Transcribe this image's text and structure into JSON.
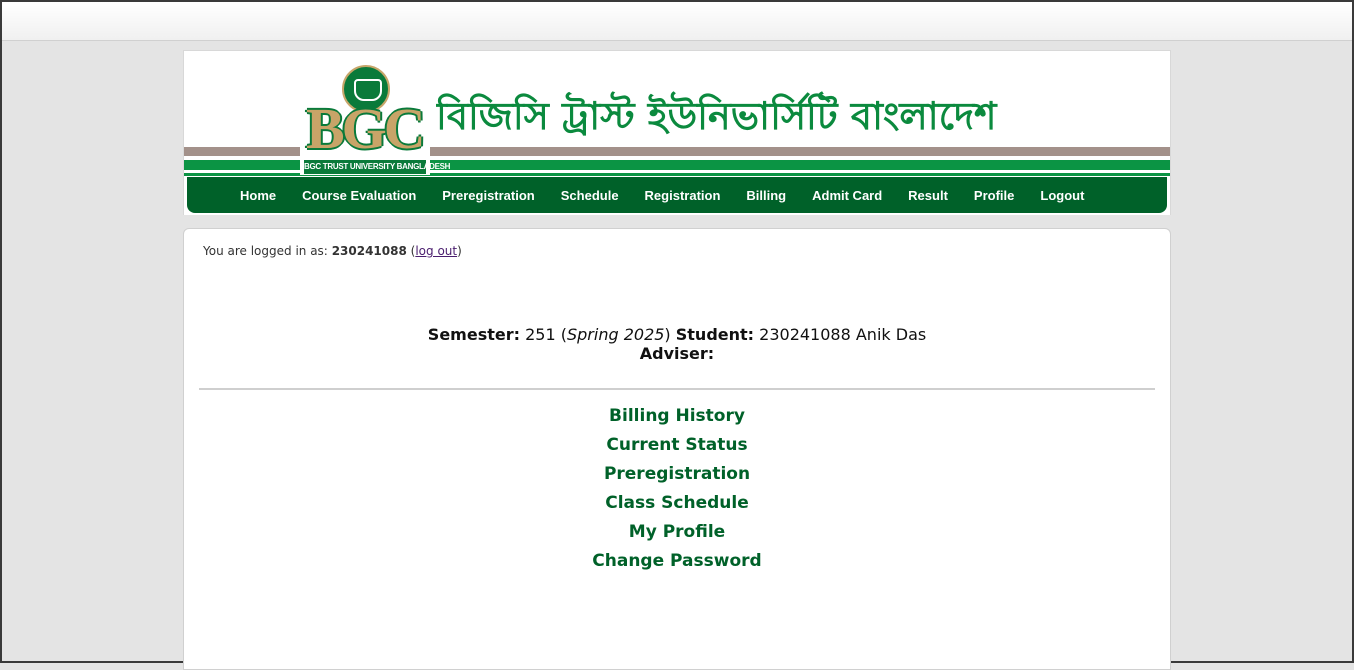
{
  "header": {
    "logo_letters": "BGC",
    "logo_caption": "BGC TRUST UNIVERSITY BANGLADESH",
    "bangla_title": "বিজিসি ট্রাস্ট ইউনিভার্সিটি বাংলাদেশ",
    "brand_colors": {
      "green": "#006129",
      "light_green": "#0b9444",
      "tan": "#c8a468",
      "gray_stripe": "#a3918a"
    }
  },
  "nav": {
    "items": [
      {
        "label": "Home"
      },
      {
        "label": "Course Evaluation"
      },
      {
        "label": "Preregistration"
      },
      {
        "label": "Schedule"
      },
      {
        "label": "Registration"
      },
      {
        "label": "Billing"
      },
      {
        "label": "Admit Card"
      },
      {
        "label": "Result"
      },
      {
        "label": "Profile"
      },
      {
        "label": "Logout"
      }
    ]
  },
  "login": {
    "prefix": "You are logged in as:",
    "user_id": "230241088",
    "logout_label": "log out"
  },
  "student_info": {
    "semester_label": "Semester:",
    "semester_value": "251",
    "semester_name": "Spring 2025",
    "student_label": "Student:",
    "student_value": "230241088 Anik Das",
    "adviser_label": "Adviser:"
  },
  "links": [
    {
      "label": "Billing History"
    },
    {
      "label": "Current Status"
    },
    {
      "label": "Preregistration"
    },
    {
      "label": "Class Schedule"
    },
    {
      "label": "My Profile"
    },
    {
      "label": "Change Password"
    }
  ]
}
